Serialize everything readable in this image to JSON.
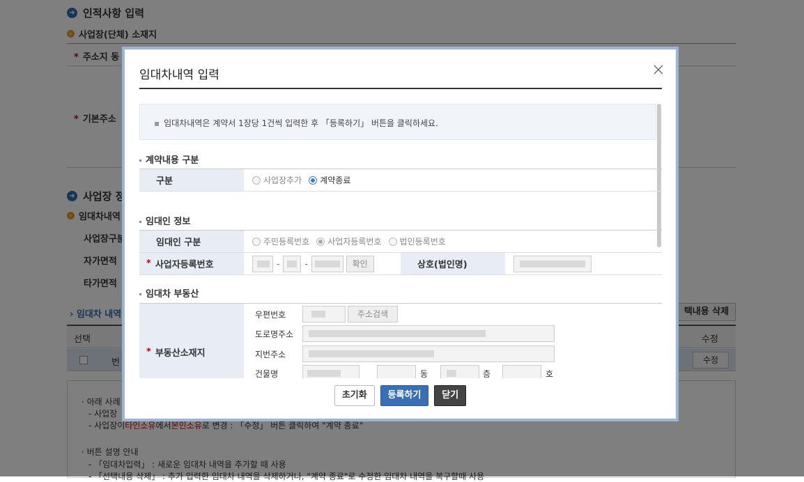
{
  "background": {
    "section1_title": "인적사항 입력",
    "section1_sub": "사업장(단체) 소재지",
    "row_address": "주소지 동",
    "row_base_address": "기본주소",
    "section2_title": "사업장 정",
    "section2_sub": "임대차내역",
    "row_biz_type": "사업장구분",
    "row_own_area": "자가면적",
    "row_other_area": "타가면적",
    "lease_list_title": "› 임대차 내역",
    "delete_selected": "택내용 삭제",
    "col_select": "선택",
    "col_edit": "수정",
    "row_text": "번",
    "edit_button": "수정",
    "guide_line1": "· 아래 사례",
    "guide_line2": "- 사업장",
    "guide_line3_a": "- 사업장이",
    "guide_line3_red1": "타인소유",
    "guide_line3_b": "에서",
    "guide_line3_red2": "본인소유",
    "guide_line3_c": "로 변경 : 「수정」 버튼 클릭하여 \"계약 종료\"",
    "guide_line4": "· 버튼 설명 안내",
    "guide_line5": "- 「임대차입력」 : 새로운 임대차 내역을 추가할 때 사용",
    "guide_line6": "- 「선택내용 삭제」 : 추가 입력한 임대차 내역을 삭제하거나, \"계약 종료\"로 수정한 임대차 내역을 복구할때 사용"
  },
  "modal": {
    "title": "임대차내역 입력",
    "notice": "임대차내역은 계약서 1장당 1건씩 입력한 후 「등록하기」 버튼을 클릭하세요.",
    "section_contract": "계약내용 구분",
    "contract_label": "구분",
    "contract_options": [
      "사업장추가",
      "계약종료"
    ],
    "section_lessor": "임대인 정보",
    "lessor_type_label": "임대인 구분",
    "lessor_type_options": [
      "주민등록번호",
      "사업자등록번호",
      "법인등록번호"
    ],
    "biz_reg_label": "사업자등록번호",
    "confirm_button": "확인",
    "company_label": "상호(법인명)",
    "section_property": "임대차 부동산",
    "property_label": "부동산소재지",
    "zip_label": "우편번호",
    "addr_search_button": "주소검색",
    "road_addr_label": "도로명주소",
    "lot_addr_label": "지번주소",
    "building_label": "건물명",
    "dong_label": "동",
    "floor_label": "층",
    "ho_label": "호",
    "reset_button": "초기화",
    "submit_button": "등록하기",
    "close_button": "닫기"
  },
  "colors": {
    "accent": "#3a6fb3",
    "required": "#cc0000",
    "header_bg": "#e8ecf5",
    "modal_border": "#9bb5d6"
  }
}
